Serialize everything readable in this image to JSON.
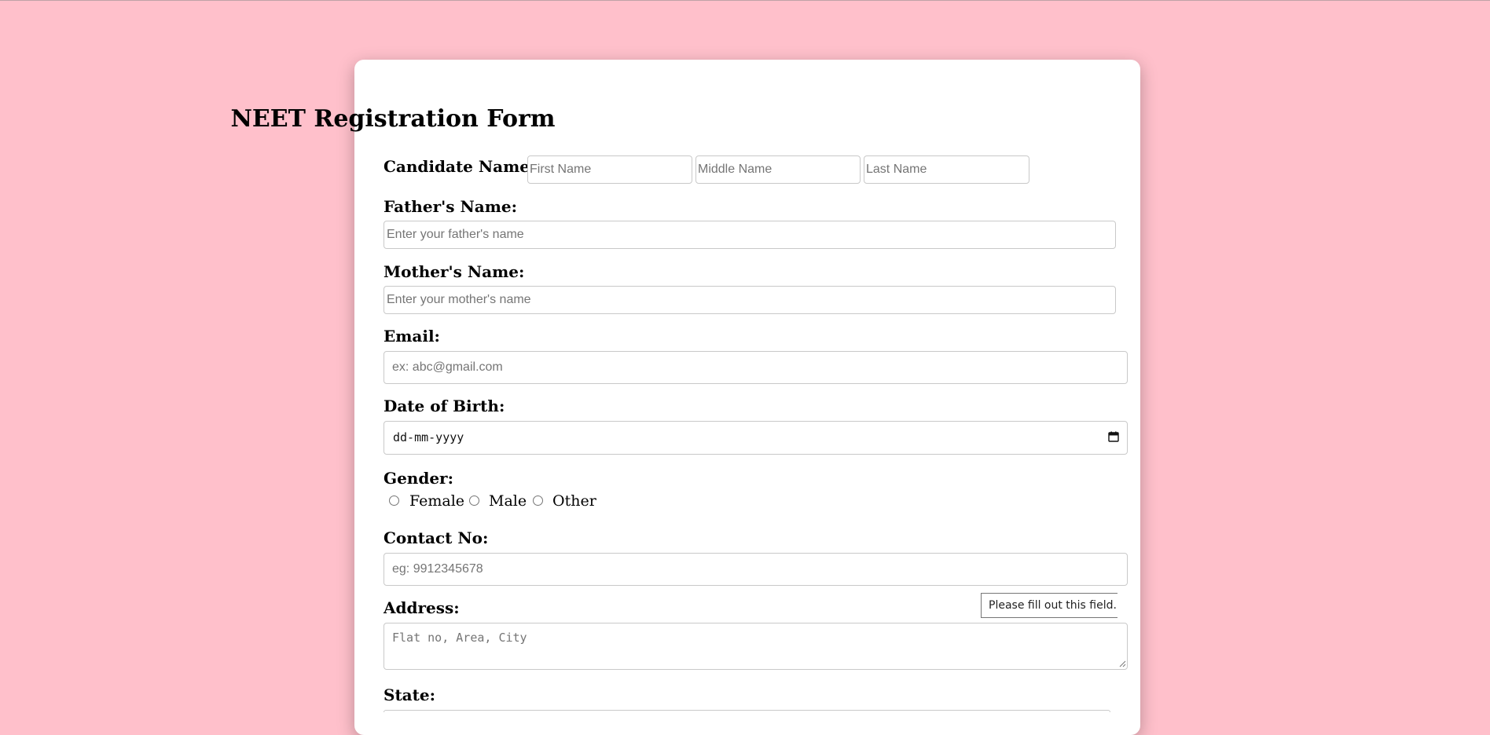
{
  "form": {
    "title": "NEET Registration Form",
    "candidate": {
      "label": "Candidate Name:",
      "first_placeholder": "First Name",
      "middle_placeholder": "Middle Name",
      "last_placeholder": "Last Name"
    },
    "father": {
      "label": "Father's Name:",
      "placeholder": "Enter your father's name"
    },
    "mother": {
      "label": "Mother's Name:",
      "placeholder": "Enter your mother's name"
    },
    "email": {
      "label": "Email:",
      "placeholder": "ex: abc@gmail.com"
    },
    "dob": {
      "label": "Date of Birth:",
      "value": "dd-mm-yyyy",
      "icon": "calendar-icon"
    },
    "gender": {
      "label": "Gender:",
      "options": [
        "Female",
        "Male",
        "Other"
      ]
    },
    "contact": {
      "label": "Contact No:",
      "placeholder": "eg: 9912345678"
    },
    "address": {
      "label": "Address:",
      "placeholder": "Flat no, Area, City"
    },
    "state": {
      "label": "State:"
    },
    "validation_tooltip": "Please fill out this field."
  },
  "colors": {
    "page_background": "#ffc0cb",
    "card_background": "#ffffff"
  }
}
